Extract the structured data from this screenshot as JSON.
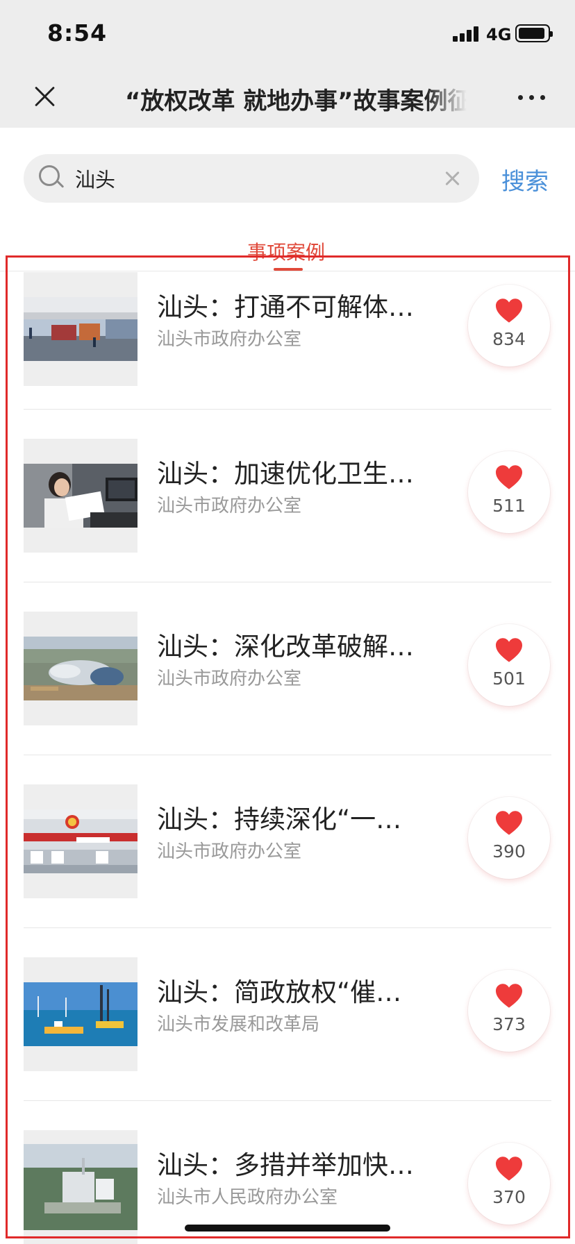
{
  "status_bar": {
    "time": "8:54",
    "network": "4G"
  },
  "nav": {
    "title": "“放权改革 就地办事”故事案例征"
  },
  "search": {
    "value": "汕头",
    "button_label": "搜索"
  },
  "tab": {
    "label": "事项案例"
  },
  "colors": {
    "accent_red": "#e0493a",
    "link_blue": "#4a90d9",
    "heart_red": "#ee3b3b"
  },
  "items": [
    {
      "title": "汕头：打通不可解体…",
      "org": "汕头市政府办公室",
      "likes": "834",
      "thumb": "toll-station-photo"
    },
    {
      "title": "汕头：加速优化卫生…",
      "org": "汕头市政府办公室",
      "likes": "511",
      "thumb": "office-worker-photo"
    },
    {
      "title": "汕头：深化改革破解…",
      "org": "汕头市政府办公室",
      "likes": "501",
      "thumb": "aerial-construction-photo"
    },
    {
      "title": "汕头：持续深化“一…",
      "org": "汕头市政府办公室",
      "likes": "390",
      "thumb": "service-hall-photo"
    },
    {
      "title": "汕头：简政放权“催…",
      "org": "汕头市发展和改革局",
      "likes": "373",
      "thumb": "offshore-wind-photo"
    },
    {
      "title": "汕头：多措并举加快…",
      "org": "汕头市人民政府办公室",
      "likes": "370",
      "thumb": "power-plant-photo"
    }
  ]
}
